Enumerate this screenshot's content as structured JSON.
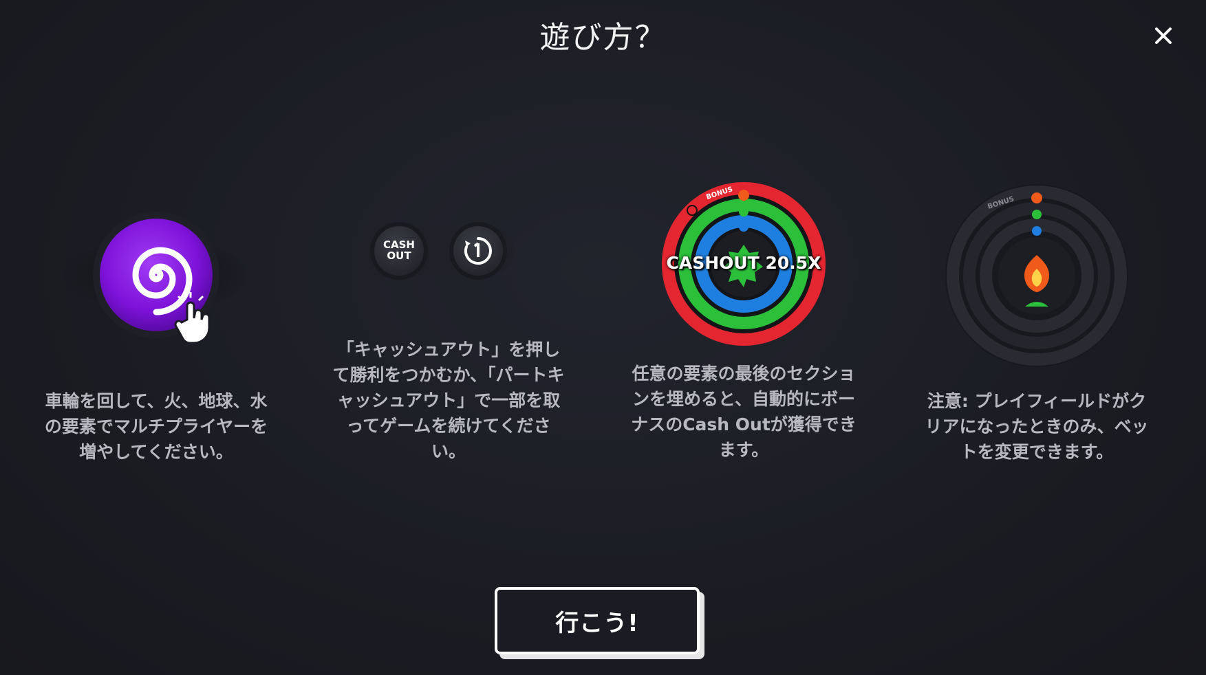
{
  "dialog": {
    "title": "遊び方？",
    "close_icon": "close-icon",
    "go_button_label": "行こう!"
  },
  "steps": [
    {
      "icon": "spin-wheel-icon",
      "text": "車輪を回して、火、地球、水の要素でマルチプライヤーを増やしてください。"
    },
    {
      "icon": "cashout-partial-cashout-icons",
      "cashout_label_line1": "CASH",
      "cashout_label_line2": "OUT",
      "text": "「キャッシュアウト」を押して勝利をつかむか、「パートキャッシュアウト」で一部を取ってゲームを続けてください。"
    },
    {
      "icon": "bonus-wheel-icon",
      "wheel_label": "CASHOUT 20.5X",
      "bonus_label": "BONUS",
      "text": "任意の要素の最後のセクションを埋めると、自動的にボーナスのCash Outが獲得できます。"
    },
    {
      "icon": "idle-wheel-icon",
      "bonus_label": "BONUS",
      "text": "注意: プレイフィールドがクリアになったときのみ、ベットを変更できます。"
    }
  ],
  "colors": {
    "background": "#1b1c23",
    "spin_purple": "#8a1fe0",
    "ring_red": "#e3262f",
    "ring_green": "#2bbf3a",
    "ring_blue": "#1f7fe0",
    "fire_orange": "#f05a1a"
  }
}
